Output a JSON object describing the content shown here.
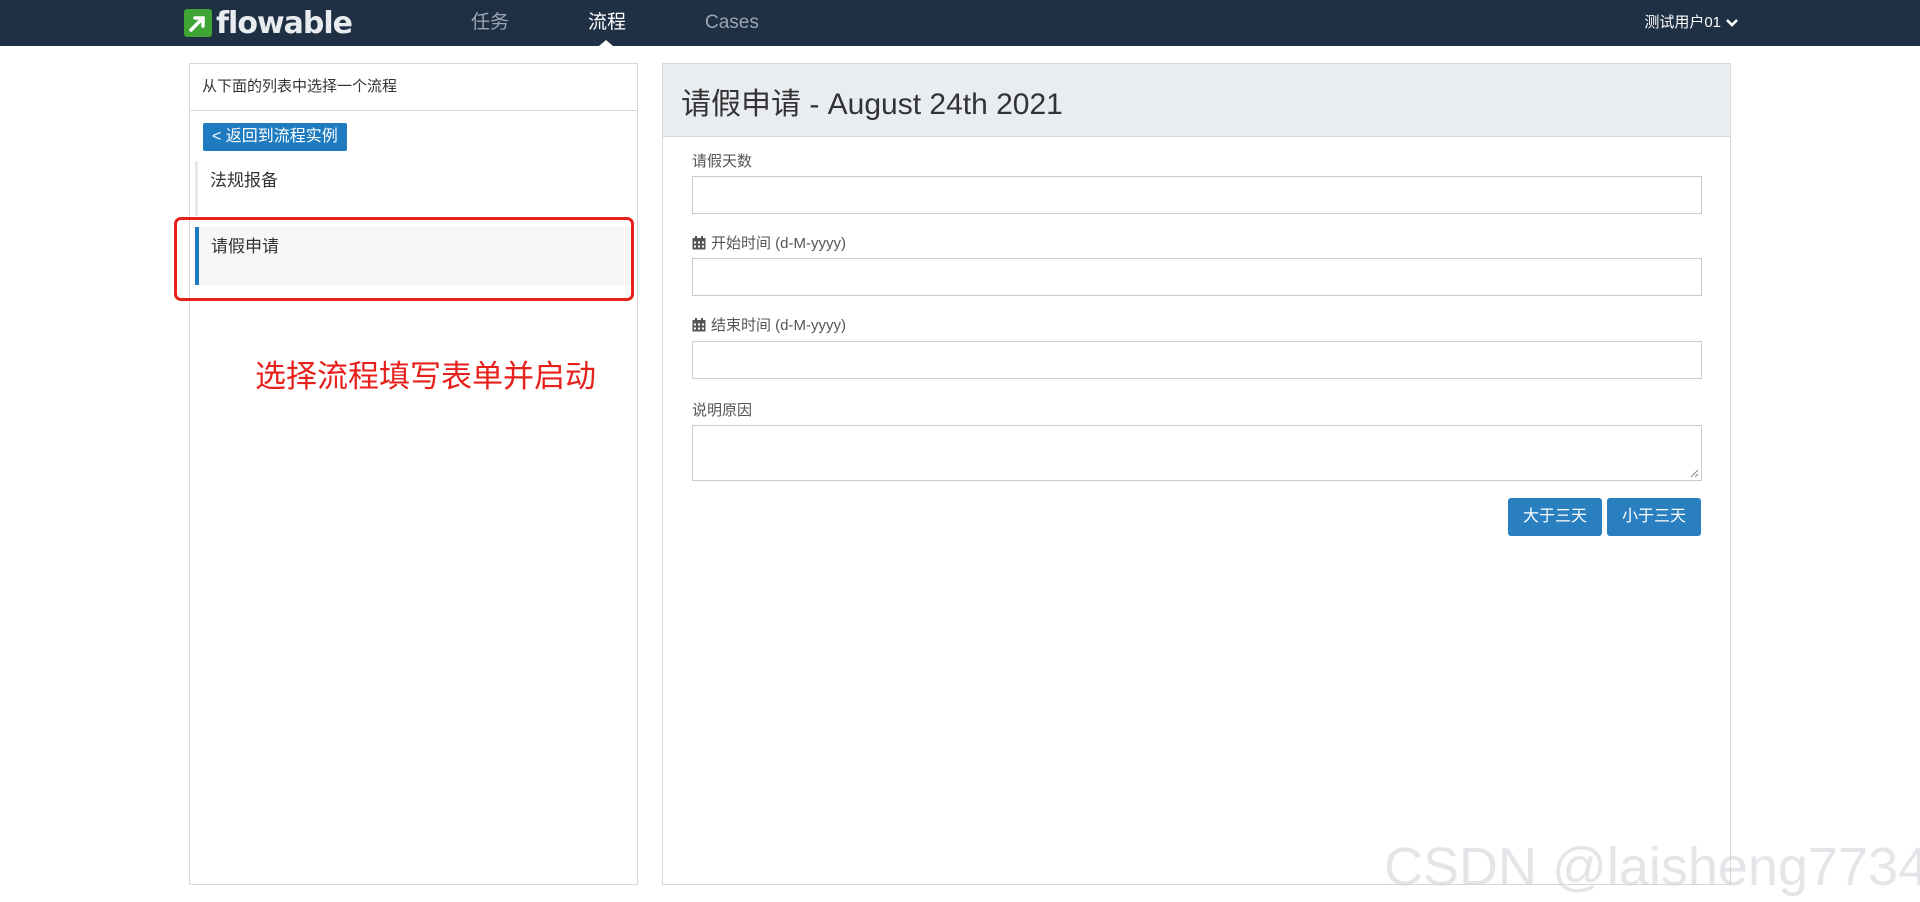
{
  "nav": {
    "logo_text": "flowable",
    "items": [
      {
        "label": "任务",
        "active": false
      },
      {
        "label": "流程",
        "active": true
      },
      {
        "label": "Cases",
        "active": false
      }
    ],
    "user": "测试用户01"
  },
  "left": {
    "header": "从下面的列表中选择一个流程",
    "back_button": "< 返回到流程实例",
    "processes": [
      {
        "label": "法规报备"
      },
      {
        "label": "请假申请"
      }
    ],
    "annotation": "选择流程填写表单并启动"
  },
  "form": {
    "title": "请假申请 - August 24th 2021",
    "fields": [
      {
        "label": "请假天数",
        "value": "",
        "icon": ""
      },
      {
        "label": "开始时间 (d-M-yyyy)",
        "value": "",
        "icon": "calendar-icon"
      },
      {
        "label": "结束时间 (d-M-yyyy)",
        "value": "",
        "icon": "calendar-icon"
      },
      {
        "label": "说明原因",
        "value": "",
        "icon": ""
      }
    ],
    "buttons": [
      {
        "label": "大于三天"
      },
      {
        "label": "小于三天"
      }
    ]
  },
  "watermark": "CSDN @laisheng7734",
  "colors": {
    "navbar": "#1f2f44",
    "primary": "#2a7fc0",
    "annotation": "#e8201c",
    "logo_green": "#3fa535"
  }
}
